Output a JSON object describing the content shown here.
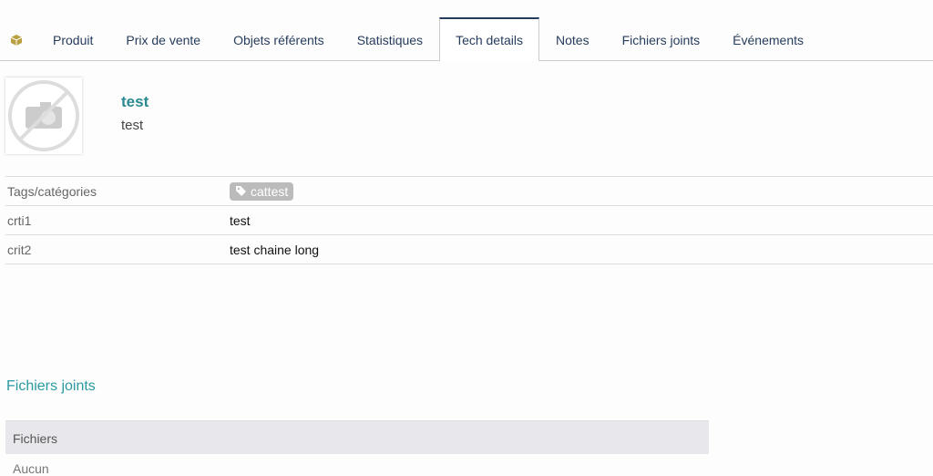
{
  "tabs": [
    {
      "label": "Produit"
    },
    {
      "label": "Prix de vente"
    },
    {
      "label": "Objets référents"
    },
    {
      "label": "Statistiques"
    },
    {
      "label": "Tech details",
      "active": true
    },
    {
      "label": "Notes"
    },
    {
      "label": "Fichiers joints"
    },
    {
      "label": "Événements"
    }
  ],
  "product": {
    "ref": "test",
    "label": "test"
  },
  "fields": [
    {
      "key": "Tags/catégories",
      "tag": "cattest"
    },
    {
      "key": "crti1",
      "value": "test"
    },
    {
      "key": "crit2",
      "value": "test chaine long"
    }
  ],
  "files": {
    "title": "Fichiers joints",
    "header": "Fichiers",
    "empty": "Aucun"
  },
  "colors": {
    "tab_text": "#263c5c",
    "accent": "#2a8a8f",
    "icon": "#b8a040"
  }
}
